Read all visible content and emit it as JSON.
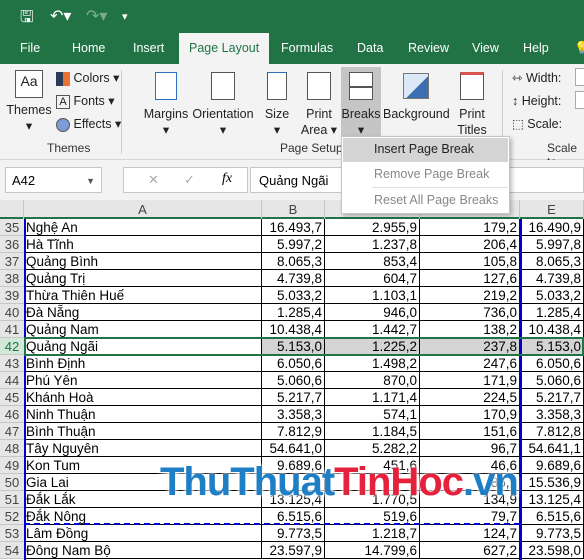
{
  "quick_access": {
    "save_icon": "save-icon",
    "undo_icon": "undo-icon",
    "redo_icon": "redo-icon",
    "customize_icon": "customize-icon"
  },
  "tabs": [
    "File",
    "Home",
    "Insert",
    "Page Layout",
    "Formulas",
    "Data",
    "Review",
    "View",
    "Help"
  ],
  "active_tab": "Page Layout",
  "ribbon": {
    "themes": {
      "themes_label": "Themes",
      "colors_label": "Colors",
      "fonts_label": "Fonts",
      "effects_label": "Effects",
      "group_label": "Themes"
    },
    "page_setup": {
      "margins": "Margins",
      "orientation": "Orientation",
      "size": "Size",
      "print_area_1": "Print",
      "print_area_2": "Area",
      "breaks": "Breaks",
      "background": "Background",
      "print_titles_1": "Print",
      "print_titles_2": "Titles",
      "group_label": "Page Setup"
    },
    "scale": {
      "width": "Width:",
      "height": "Height:",
      "scale": "Scale:",
      "group_label": "Scale to"
    }
  },
  "breaks_menu": [
    "Insert Page Break",
    "Remove Page Break",
    "Reset All Page Breaks"
  ],
  "formula_bar": {
    "name_box": "A42",
    "fx": "fx",
    "value": "Quảng Ngãi"
  },
  "columns": [
    "A",
    "B",
    "C",
    "D",
    "E"
  ],
  "rows": [
    {
      "n": "35",
      "a": "Nghệ An",
      "b": "16.493,7",
      "c": "2.955,9",
      "d": "179,2",
      "e": "16.490,9"
    },
    {
      "n": "36",
      "a": "Hà Tĩnh",
      "b": "5.997,2",
      "c": "1.237,8",
      "d": "206,4",
      "e": "5.997,8"
    },
    {
      "n": "37",
      "a": "Quảng Bình",
      "b": "8.065,3",
      "c": "853,4",
      "d": "105,8",
      "e": "8.065,3"
    },
    {
      "n": "38",
      "a": "Quảng Trị",
      "b": "4.739,8",
      "c": "604,7",
      "d": "127,6",
      "e": "4.739,8"
    },
    {
      "n": "39",
      "a": "Thừa Thiên Huế",
      "b": "5.033,2",
      "c": "1.103,1",
      "d": "219,2",
      "e": "5.033,2"
    },
    {
      "n": "40",
      "a": "Đà Nẵng",
      "b": "1.285,4",
      "c": "946,0",
      "d": "736,0",
      "e": "1.285,4"
    },
    {
      "n": "41",
      "a": "Quảng Nam",
      "b": "10.438,4",
      "c": "1.442,7",
      "d": "138,2",
      "e": "10.438,4"
    },
    {
      "n": "42",
      "a": "Quảng Ngãi",
      "b": "5.153,0",
      "c": "1.225,2",
      "d": "237,8",
      "e": "5.153,0"
    },
    {
      "n": "43",
      "a": "Bình Định",
      "b": "6.050,6",
      "c": "1.498,2",
      "d": "247,6",
      "e": "6.050,6"
    },
    {
      "n": "44",
      "a": "Phú Yên",
      "b": "5.060,6",
      "c": "870,0",
      "d": "171,9",
      "e": "5.060,6"
    },
    {
      "n": "45",
      "a": "Khánh Hoà",
      "b": "5.217,7",
      "c": "1.171,4",
      "d": "224,5",
      "e": "5.217,7"
    },
    {
      "n": "46",
      "a": "Ninh Thuận",
      "b": "3.358,3",
      "c": "574,1",
      "d": "170,9",
      "e": "3.358,3"
    },
    {
      "n": "47",
      "a": "Bình Thuận",
      "b": "7.812,9",
      "c": "1.184,5",
      "d": "151,6",
      "e": "7.812,8"
    },
    {
      "n": "48",
      "a": "Tây Nguyên",
      "b": "54.641,0",
      "c": "5.282,2",
      "d": "96,7",
      "e": "54.641,1"
    },
    {
      "n": "49",
      "a": "Kon Tum",
      "b": "9.689,6",
      "c": "451,6",
      "d": "46,6",
      "e": "9.689,6"
    },
    {
      "n": "50",
      "a": "Gia Lai",
      "b": "",
      "c": "",
      "d": "85,1",
      "e": "15.536,9"
    },
    {
      "n": "51",
      "a": "Đắk Lắk",
      "b": "13.125,4",
      "c": "1.770,5",
      "d": "134,9",
      "e": "13.125,4"
    },
    {
      "n": "52",
      "a": "Đắk Nông",
      "b": "6.515,6",
      "c": "519,6",
      "d": "79,7",
      "e": "6.515,6"
    },
    {
      "n": "53",
      "a": "Lâm Đồng",
      "b": "9.773,5",
      "c": "1.218,7",
      "d": "124,7",
      "e": "9.773,5"
    },
    {
      "n": "54",
      "a": "Đông Nam Bộ",
      "b": "23.597,9",
      "c": "14.799,6",
      "d": "627,2",
      "e": "23.598,0"
    }
  ],
  "selected_row": "42",
  "watermark": {
    "part1": "ThuThuat",
    "part2": "TinHoc",
    "part3": ".vn"
  },
  "colors": {
    "excel_green": "#217346",
    "page_break": "#0000cc",
    "watermark_blue": "#1e7fc6",
    "watermark_red": "#e5213b"
  }
}
